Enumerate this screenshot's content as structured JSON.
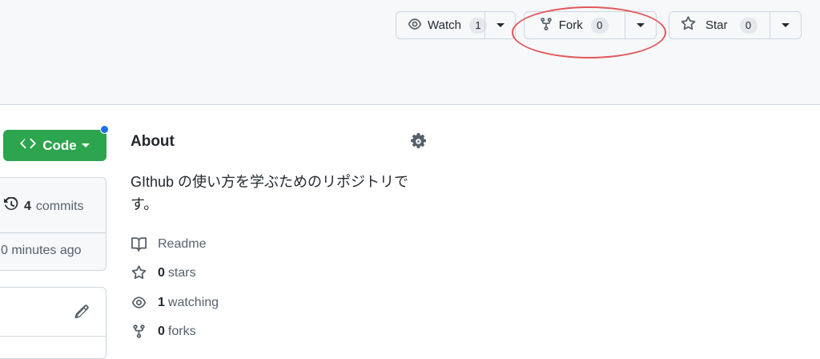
{
  "header": {
    "watch": {
      "label": "Watch",
      "count": "1",
      "icon": "eye-icon"
    },
    "fork": {
      "label": "Fork",
      "count": "0",
      "icon": "repo-forked-icon"
    },
    "star": {
      "label": "Star",
      "count": "0",
      "icon": "star-icon"
    }
  },
  "code_button": {
    "label": "Code",
    "icon": "code-icon"
  },
  "commits": {
    "count": "4",
    "label": "commits",
    "time_ago": "0 minutes ago",
    "icon": "history-icon"
  },
  "about": {
    "title": "About",
    "description": "GIthub の使い方を学ぶためのリポジトリです。",
    "readme": "Readme",
    "stars_count": "0",
    "stars_label": "stars",
    "watching_count": "1",
    "watching_label": "watching",
    "forks_count": "0",
    "forks_label": "forks"
  },
  "colors": {
    "primary": "#2da44e",
    "highlight": "#e0585a",
    "dot": "#1f6feb"
  }
}
